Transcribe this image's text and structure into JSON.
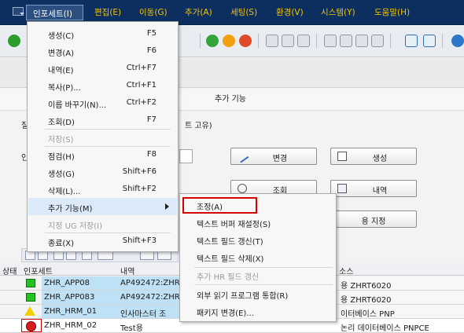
{
  "menubar": {
    "items": [
      "인포세트(I)",
      "편집(E)",
      "이동(G)",
      "추가(A)",
      "세팅(S)",
      "환경(V)",
      "시스템(Y)",
      "도움말(H)"
    ]
  },
  "colors": {
    "menubar": "#0d2f5f",
    "menu_text": "#f5c400",
    "highlight": "#d40000",
    "row_selected": "#bfe1f5"
  },
  "screen": {
    "appbar_label": "추가 기능",
    "hint_text": "트 고유)",
    "row_label_1": "질",
    "row_label_2": "인"
  },
  "buttons": {
    "change": "변경",
    "create": "생성",
    "display": "조회",
    "description": "내역",
    "assign": "용 지정"
  },
  "grid": {
    "headers": {
      "status": "상태",
      "infoset": "인포세트",
      "desc": "내역",
      "source": "소스"
    },
    "rows": [
      {
        "status": "green",
        "infoset": "ZHR_APP08",
        "desc": "AP492472:ZHR",
        "source": "용 ZHRT6020"
      },
      {
        "status": "green",
        "infoset": "ZHR_APP083",
        "desc": "AP492472:ZHR",
        "source": "용 ZHRT6020"
      },
      {
        "status": "yellow",
        "infoset": "ZHR_HRM_01",
        "desc": "인사마스터 조",
        "source": "이터베이스 PNP"
      },
      {
        "status": "red",
        "infoset": "ZHR_HRM_02",
        "desc": "Test용",
        "source": "논리 데이터베이스 PNPCE"
      }
    ]
  },
  "menu": {
    "items": [
      {
        "label": "생성(C)",
        "shortcut": "F5",
        "disabled": false
      },
      {
        "label": "변경(A)",
        "shortcut": "F6",
        "disabled": false
      },
      {
        "label": "내역(E)",
        "shortcut": "Ctrl+F7",
        "disabled": false
      },
      {
        "label": "복사(P)...",
        "shortcut": "Ctrl+F1",
        "disabled": false
      },
      {
        "label": "이름 바꾸기(N)...",
        "shortcut": "Ctrl+F2",
        "disabled": false
      },
      {
        "label": "조회(D)",
        "shortcut": "F7",
        "disabled": false
      },
      {
        "label": "저장(S)",
        "shortcut": "",
        "disabled": true
      },
      {
        "label": "점검(H)",
        "shortcut": "F8",
        "disabled": false
      },
      {
        "label": "생성(G)",
        "shortcut": "Shift+F6",
        "disabled": false
      },
      {
        "label": "삭제(L)...",
        "shortcut": "Shift+F2",
        "disabled": false
      },
      {
        "label": "추가 기능(M)",
        "shortcut": "",
        "disabled": false
      },
      {
        "label": "지정 UG 저장(I)",
        "shortcut": "",
        "disabled": true
      },
      {
        "label": "종료(X)",
        "shortcut": "Shift+F3",
        "disabled": false
      }
    ]
  },
  "submenu": {
    "items": [
      {
        "label": "조정(A)",
        "disabled": false
      },
      {
        "label": "텍스트 버퍼 재설정(S)",
        "disabled": false
      },
      {
        "label": "텍스트 필드 갱신(T)",
        "disabled": false
      },
      {
        "label": "텍스트 필드 삭제(X)",
        "disabled": false
      },
      {
        "label": "추가 HR 필드 갱신",
        "disabled": true
      },
      {
        "label": "외부 읽기 프로그램 통합(R)",
        "disabled": false
      },
      {
        "label": "패키지 변경(E)...",
        "disabled": false
      }
    ]
  }
}
